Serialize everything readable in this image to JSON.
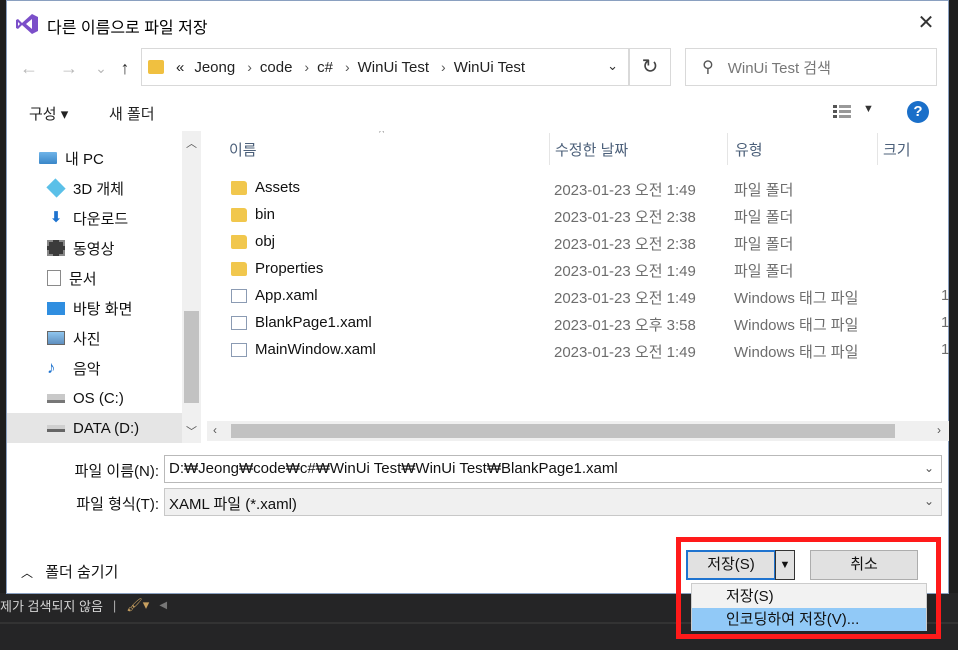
{
  "dialog": {
    "title": "다른 이름으로 파일 저장",
    "close_label": "✕"
  },
  "nav": {
    "back": "←",
    "forward": "→",
    "recent": "⌄",
    "up": "↑"
  },
  "address": {
    "prefix": "«",
    "crumbs": [
      "Jeong",
      "code",
      "c#",
      "WinUi Test",
      "WinUi Test"
    ],
    "separator": "›"
  },
  "search": {
    "placeholder": "WinUi Test 검색"
  },
  "toolbar": {
    "organize_label": "구성 ▾",
    "new_folder_label": "새 폴더"
  },
  "sidebar": {
    "items": [
      {
        "label": "내 PC",
        "icon": "pc-icon"
      },
      {
        "label": "3D 개체",
        "icon": "3d-objects-icon"
      },
      {
        "label": "다운로드",
        "icon": "download-icon"
      },
      {
        "label": "동영상",
        "icon": "video-icon"
      },
      {
        "label": "문서",
        "icon": "document-icon"
      },
      {
        "label": "바탕 화면",
        "icon": "desktop-icon"
      },
      {
        "label": "사진",
        "icon": "pictures-icon"
      },
      {
        "label": "음악",
        "icon": "music-icon"
      },
      {
        "label": "OS (C:)",
        "icon": "drive-c-icon"
      },
      {
        "label": "DATA (D:)",
        "icon": "drive-d-icon"
      }
    ],
    "selected": "DATA (D:)"
  },
  "columns": {
    "name": "이름",
    "date": "수정한 날짜",
    "type": "유형",
    "size": "크기"
  },
  "files": [
    {
      "name": "Assets",
      "date": "2023-01-23 오전 1:49",
      "type": "파일 폴더",
      "size": "",
      "kind": "folder"
    },
    {
      "name": "bin",
      "date": "2023-01-23 오전 2:38",
      "type": "파일 폴더",
      "size": "",
      "kind": "folder"
    },
    {
      "name": "obj",
      "date": "2023-01-23 오전 2:38",
      "type": "파일 폴더",
      "size": "",
      "kind": "folder"
    },
    {
      "name": "Properties",
      "date": "2023-01-23 오전 1:49",
      "type": "파일 폴더",
      "size": "",
      "kind": "folder"
    },
    {
      "name": "App.xaml",
      "date": "2023-01-23 오전 1:49",
      "type": "Windows 태그 파일",
      "size": "1",
      "kind": "file"
    },
    {
      "name": "BlankPage1.xaml",
      "date": "2023-01-23 오후 3:58",
      "type": "Windows 태그 파일",
      "size": "1",
      "kind": "file"
    },
    {
      "name": "MainWindow.xaml",
      "date": "2023-01-23 오전 1:49",
      "type": "Windows 태그 파일",
      "size": "1",
      "kind": "file"
    }
  ],
  "form": {
    "filename_label": "파일 이름(N):",
    "filename_value": "D:₩Jeong₩code₩c#₩WinUi Test₩WinUi Test₩BlankPage1.xaml",
    "filetype_label": "파일 형식(T):",
    "filetype_value": "XAML 파일 (*.xaml)"
  },
  "hide_folders_label": "폴더 숨기기",
  "buttons": {
    "save_label": "저장(S)",
    "cancel_label": "취소"
  },
  "save_menu": {
    "items": [
      "저장(S)",
      "인코딩하여 저장(V)..."
    ],
    "highlighted_index": 1
  },
  "ide_status": {
    "text": "제가 검색되지 않음",
    "separator": "|"
  },
  "colors": {
    "accent": "#1e73cf",
    "menu_highlight": "#91c9f7",
    "annotation": "#ff1a1a",
    "folder": "#f1c74d"
  }
}
